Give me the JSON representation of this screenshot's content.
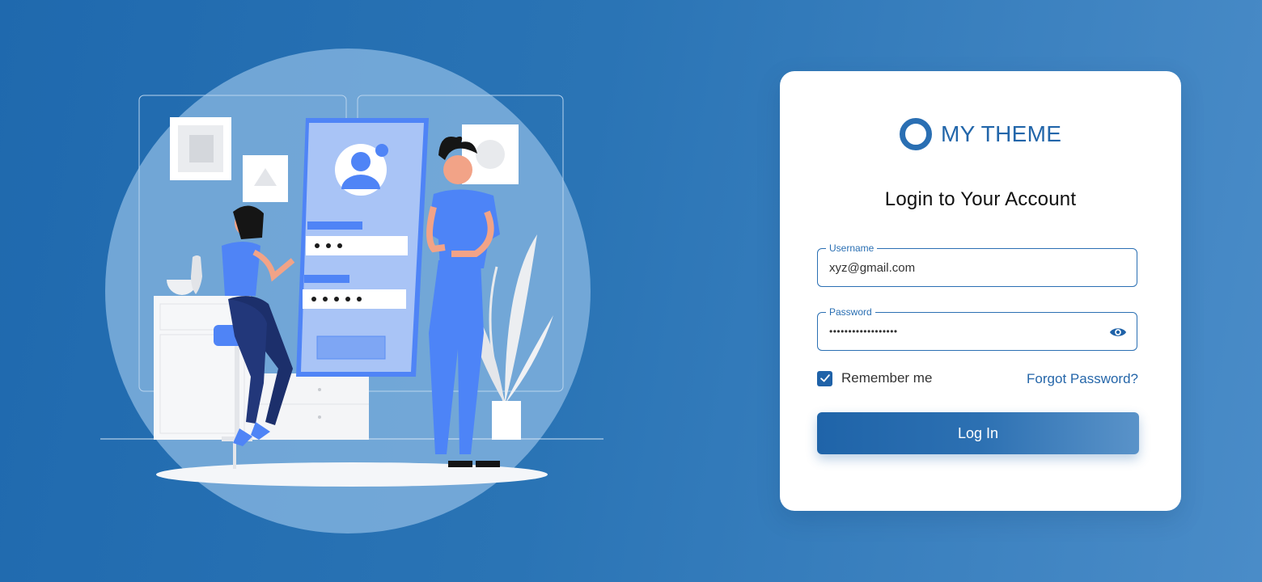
{
  "brand": {
    "name": "MY THEME",
    "color": "#2266aa"
  },
  "login": {
    "title": "Login to Your Account",
    "username": {
      "label": "Username",
      "value": "xyz@gmail.com"
    },
    "password": {
      "label": "Password",
      "value": "••••••••••••••••••",
      "toggle_icon": "eye-icon"
    },
    "remember": {
      "label": "Remember me",
      "checked": true
    },
    "forgot_label": "Forgot Password?",
    "submit_label": "Log In"
  },
  "illustration": {
    "subject": "two people with a large phone showing a login form",
    "screen_avatar_icon": "user-icon"
  },
  "colors": {
    "background": "#2a74b5",
    "accent": "#2a6fb3",
    "illustration_blue": "#4d84f7"
  }
}
